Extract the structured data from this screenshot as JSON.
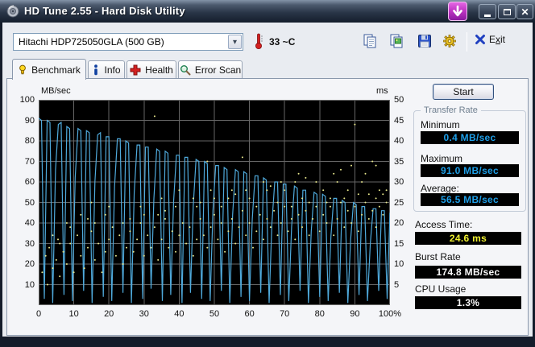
{
  "window": {
    "title": "HD Tune 2.55 - Hard Disk Utility"
  },
  "toolbar": {
    "drive_select_value": "Hitachi HDP725050GLA (500 GB)",
    "temperature": "33 ~C",
    "exit": {
      "pre": "E",
      "key": "x",
      "post": "it"
    }
  },
  "tabs": [
    {
      "label": "Benchmark",
      "icon": "lightbulb-icon",
      "active": true
    },
    {
      "label": "Info",
      "icon": "info-icon",
      "active": false
    },
    {
      "label": "Health",
      "icon": "red-cross-icon",
      "active": false
    },
    {
      "label": "Error Scan",
      "icon": "magnifier-icon",
      "active": false
    }
  ],
  "panel": {
    "start_label": "Start",
    "transfer_rate": {
      "legend": "Transfer Rate",
      "rows": [
        {
          "label": "Minimum",
          "value": "0.4 MB/sec"
        },
        {
          "label": "Maximum",
          "value": "91.0 MB/sec"
        },
        {
          "label": "Average:",
          "value": "56.5 MB/sec"
        }
      ]
    },
    "extras": [
      {
        "label": "Access Time:",
        "value": "24.6 ms"
      },
      {
        "label": "Burst Rate",
        "value": "174.8 MB/sec"
      },
      {
        "label": "CPU Usage",
        "value": "1.3%"
      }
    ]
  },
  "chart_data": {
    "type": "line",
    "title": "",
    "left_axis": {
      "label": "MB/sec",
      "min": 0,
      "max": 100,
      "ticks": [
        100,
        90,
        80,
        70,
        60,
        50,
        40,
        30,
        20,
        10
      ]
    },
    "right_axis": {
      "label": "ms",
      "min": 0,
      "max": 50,
      "ticks": [
        50,
        45,
        40,
        35,
        30,
        25,
        20,
        15,
        10,
        5
      ]
    },
    "x_axis": {
      "min": 0,
      "max": 100,
      "tick_values": [
        0,
        10,
        20,
        30,
        40,
        50,
        60,
        70,
        80,
        90,
        100
      ],
      "tick_labels": [
        "0",
        "10",
        "20",
        "30",
        "40",
        "50",
        "60",
        "70",
        "80",
        "90",
        "100%"
      ]
    },
    "grid": true,
    "colors": {
      "plot_bg": "#000000",
      "grid": "#666666",
      "transfer_line": "#4faadc",
      "access_dots": "#e8e88c"
    },
    "series": [
      {
        "name": "Transfer rate (MB/sec, left axis)",
        "kind": "line",
        "x_start": 0,
        "x_step": 0.8,
        "values": [
          91,
          90,
          3,
          90,
          89,
          1,
          66,
          88,
          89,
          5,
          87,
          86,
          2,
          62,
          86,
          85,
          7,
          85,
          84,
          1,
          60,
          83,
          84,
          4,
          82,
          82,
          2,
          58,
          81,
          81,
          6,
          80,
          79,
          1,
          55,
          78,
          78,
          3,
          77,
          77,
          8,
          52,
          76,
          75,
          2,
          75,
          74,
          5,
          50,
          73,
          73,
          1,
          72,
          72,
          6,
          48,
          71,
          70,
          3,
          70,
          69,
          2,
          46,
          68,
          68,
          7,
          67,
          66,
          1,
          44,
          66,
          65,
          4,
          65,
          64,
          2,
          42,
          63,
          63,
          6,
          62,
          61,
          1,
          40,
          60,
          60,
          5,
          59,
          59,
          2,
          38,
          58,
          57,
          7,
          56,
          56,
          1,
          36,
          55,
          54,
          4,
          54,
          53,
          2,
          34,
          52,
          52,
          6,
          51,
          50,
          1,
          32,
          50,
          49,
          5,
          48,
          48,
          2,
          30,
          47,
          47,
          7,
          46,
          46,
          3,
          45
        ]
      },
      {
        "name": "Access time (ms, right axis)",
        "kind": "scatter",
        "points": [
          [
            1,
            8
          ],
          [
            2,
            12
          ],
          [
            2.5,
            5
          ],
          [
            3,
            14
          ],
          [
            4,
            17
          ],
          [
            4,
            9
          ],
          [
            5,
            11
          ],
          [
            5.5,
            16
          ],
          [
            6,
            7
          ],
          [
            6,
            15
          ],
          [
            7,
            13
          ],
          [
            8,
            10
          ],
          [
            8,
            20
          ],
          [
            9,
            15
          ],
          [
            9,
            19
          ],
          [
            10,
            8
          ],
          [
            11,
            17
          ],
          [
            12,
            12
          ],
          [
            12,
            22
          ],
          [
            13,
            9
          ],
          [
            14,
            14
          ],
          [
            14,
            21
          ],
          [
            15,
            18
          ],
          [
            15,
            25
          ],
          [
            16,
            11
          ],
          [
            16,
            20
          ],
          [
            17,
            15
          ],
          [
            18,
            8
          ],
          [
            19,
            13
          ],
          [
            19,
            22
          ],
          [
            20,
            16
          ],
          [
            20,
            24
          ],
          [
            21,
            19
          ],
          [
            22,
            12
          ],
          [
            23,
            17
          ],
          [
            24,
            10
          ],
          [
            24,
            20
          ],
          [
            25,
            14
          ],
          [
            26,
            18
          ],
          [
            26,
            21
          ],
          [
            27,
            13
          ],
          [
            28,
            16
          ],
          [
            29,
            20
          ],
          [
            29,
            24
          ],
          [
            30,
            12
          ],
          [
            30,
            22
          ],
          [
            31,
            17
          ],
          [
            32,
            14
          ],
          [
            33,
            19
          ],
          [
            33,
            46
          ],
          [
            34,
            11
          ],
          [
            34,
            22
          ],
          [
            35,
            16
          ],
          [
            35,
            26
          ],
          [
            36,
            21
          ],
          [
            36,
            23
          ],
          [
            37,
            14
          ],
          [
            38,
            18
          ],
          [
            39,
            13
          ],
          [
            39,
            24
          ],
          [
            40,
            17
          ],
          [
            40,
            28
          ],
          [
            41,
            20
          ],
          [
            42,
            15
          ],
          [
            43,
            19
          ],
          [
            44,
            12
          ],
          [
            44,
            26
          ],
          [
            45,
            16
          ],
          [
            45,
            24
          ],
          [
            46,
            21
          ],
          [
            46,
            25
          ],
          [
            47,
            17
          ],
          [
            48,
            14
          ],
          [
            48,
            35
          ],
          [
            49,
            19
          ],
          [
            49,
            28
          ],
          [
            50,
            22
          ],
          [
            50,
            26
          ],
          [
            51,
            16
          ],
          [
            52,
            20
          ],
          [
            52,
            24
          ],
          [
            53,
            13
          ],
          [
            54,
            18
          ],
          [
            54,
            26
          ],
          [
            55,
            21
          ],
          [
            55,
            28
          ],
          [
            56,
            15
          ],
          [
            56,
            27
          ],
          [
            57,
            19
          ],
          [
            58,
            23
          ],
          [
            58,
            36
          ],
          [
            59,
            17
          ],
          [
            59,
            28
          ],
          [
            60,
            20
          ],
          [
            60,
            26
          ],
          [
            61,
            14
          ],
          [
            62,
            18
          ],
          [
            62,
            24
          ],
          [
            63,
            22
          ],
          [
            64,
            16
          ],
          [
            64,
            30
          ],
          [
            65,
            21
          ],
          [
            65,
            28
          ],
          [
            66,
            19
          ],
          [
            66,
            29
          ],
          [
            67,
            23
          ],
          [
            68,
            17
          ],
          [
            68,
            25
          ],
          [
            69,
            20
          ],
          [
            69,
            30
          ],
          [
            70,
            24
          ],
          [
            70,
            28
          ],
          [
            71,
            18
          ],
          [
            72,
            21
          ],
          [
            72,
            24
          ],
          [
            73,
            16
          ],
          [
            73,
            30
          ],
          [
            74,
            22
          ],
          [
            74,
            32
          ],
          [
            75,
            19
          ],
          [
            75,
            26
          ],
          [
            76,
            23
          ],
          [
            76,
            31
          ],
          [
            77,
            17
          ],
          [
            77,
            25
          ],
          [
            78,
            21
          ],
          [
            79,
            24
          ],
          [
            79,
            30
          ],
          [
            80,
            18
          ],
          [
            81,
            22
          ],
          [
            81,
            28
          ],
          [
            82,
            20
          ],
          [
            82,
            25
          ],
          [
            83,
            24
          ],
          [
            83,
            26
          ],
          [
            84,
            17
          ],
          [
            84,
            32
          ],
          [
            85,
            21
          ],
          [
            85,
            30
          ],
          [
            86,
            25
          ],
          [
            86,
            33
          ],
          [
            87,
            19
          ],
          [
            87,
            26
          ],
          [
            88,
            23
          ],
          [
            88,
            28
          ],
          [
            89,
            20
          ],
          [
            89,
            34
          ],
          [
            90,
            24
          ],
          [
            90,
            44
          ],
          [
            91,
            18
          ],
          [
            91,
            27
          ],
          [
            92,
            22
          ],
          [
            92,
            30
          ],
          [
            93,
            25
          ],
          [
            93,
            32
          ],
          [
            94,
            21
          ],
          [
            94,
            27
          ],
          [
            95,
            23
          ],
          [
            95,
            35
          ],
          [
            96,
            19
          ],
          [
            96,
            26
          ],
          [
            96,
            34
          ],
          [
            97,
            24
          ],
          [
            97,
            28
          ],
          [
            98,
            22
          ],
          [
            98,
            27
          ],
          [
            99,
            25
          ],
          [
            99,
            28
          ]
        ]
      }
    ]
  }
}
